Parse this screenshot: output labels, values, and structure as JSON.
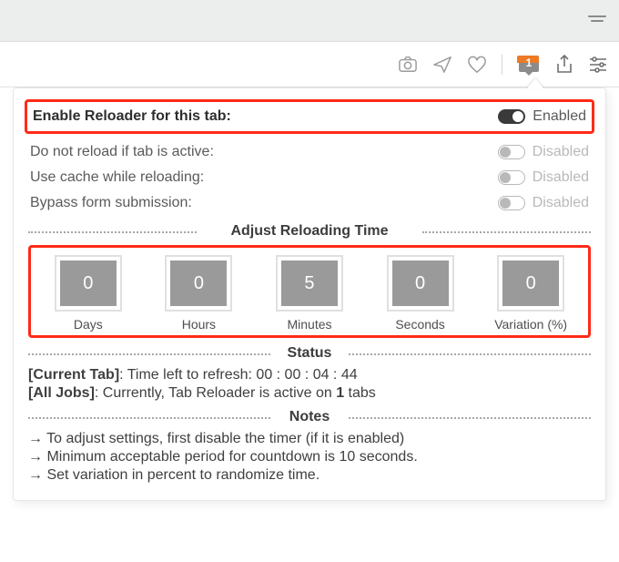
{
  "toolbar": {
    "extension_badge_count": "1"
  },
  "popup": {
    "toggles": {
      "enable": {
        "label": "Enable Reloader for this tab:",
        "state": "Enabled"
      },
      "active": {
        "label": "Do not reload if tab is active:",
        "state": "Disabled"
      },
      "cache": {
        "label": "Use cache while reloading:",
        "state": "Disabled"
      },
      "bypass": {
        "label": "Bypass form submission:",
        "state": "Disabled"
      }
    },
    "sections": {
      "adjust": "Adjust Reloading Time",
      "status": "Status",
      "notes": "Notes"
    },
    "time": {
      "days": {
        "value": "0",
        "label": "Days"
      },
      "hours": {
        "value": "0",
        "label": "Hours"
      },
      "minutes": {
        "value": "5",
        "label": "Minutes"
      },
      "seconds": {
        "value": "0",
        "label": "Seconds"
      },
      "variation": {
        "value": "0",
        "label": "Variation (%)"
      }
    },
    "status": {
      "current_prefix": "[Current Tab]",
      "current_text_a": ": Time left to refresh: ",
      "current_countdown": "00 : 00 : 04 : 44",
      "all_prefix": "[All Jobs]",
      "all_text_a": ": Currently, Tab Reloader is active on ",
      "all_count": "1",
      "all_text_b": " tabs"
    },
    "notes": {
      "n1": "→ To adjust settings, first disable the timer (if it is enabled)",
      "n2": "→ Minimum acceptable period for countdown is 10 seconds.",
      "n3": "→ Set variation in percent to randomize time."
    }
  }
}
